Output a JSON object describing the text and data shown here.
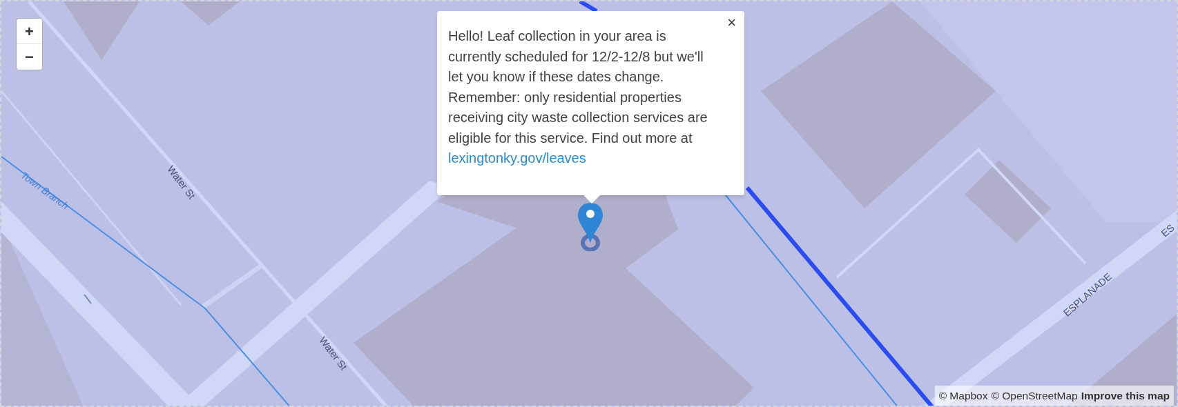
{
  "zoom_controls": [
    "+",
    "−"
  ],
  "map_labels": [
    {
      "kind": "waterway",
      "text": "Town Branch"
    },
    {
      "kind": "street",
      "text": "Water St"
    },
    {
      "kind": "street",
      "text": "Water St"
    },
    {
      "kind": "street",
      "text": "ESPLANADE"
    },
    {
      "kind": "street",
      "text": "ES"
    }
  ],
  "popup": {
    "close": "×",
    "message": "Hello! Leaf collection in your area is currently scheduled for 12/2-12/8 but we'll let you know if these dates change. Remember: only residential properties receiving city waste collection services are eligible for this service. Find out more at",
    "link": "lexingtonky.gov/leaves"
  },
  "attribution": {
    "credits": [
      "© Mapbox",
      "© OpenStreetMap"
    ],
    "improve_link": "Improve this map"
  }
}
